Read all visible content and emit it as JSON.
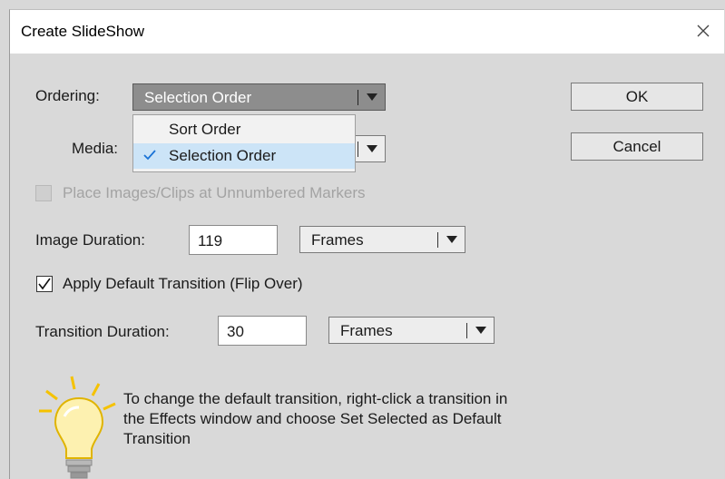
{
  "window": {
    "title": "Create SlideShow"
  },
  "ordering": {
    "label": "Ordering:",
    "selected": "Selection Order",
    "options": [
      {
        "label": "Sort Order",
        "checked": false
      },
      {
        "label": "Selection Order",
        "checked": true
      }
    ]
  },
  "media": {
    "label": "Media:"
  },
  "buttons": {
    "ok": "OK",
    "cancel": "Cancel"
  },
  "place_markers": {
    "label": "Place Images/Clips at Unnumbered Markers",
    "checked": false,
    "enabled": false
  },
  "image_duration": {
    "label": "Image Duration:",
    "value": "119",
    "unit": "Frames"
  },
  "apply_transition": {
    "label": "Apply Default Transition (Flip Over)",
    "checked": true
  },
  "transition_duration": {
    "label": "Transition Duration:",
    "value": "30",
    "unit": "Frames"
  },
  "tip": {
    "icon": "lightbulb-icon",
    "lines": [
      "To change the default transition, right-click a transition in",
      "the Effects window and choose Set Selected as Default",
      "Transition"
    ]
  },
  "colors": {
    "selection_highlight": "#cce4f7",
    "check_mark": "#1a73d6",
    "dialog_bg": "#d9d9d9"
  }
}
